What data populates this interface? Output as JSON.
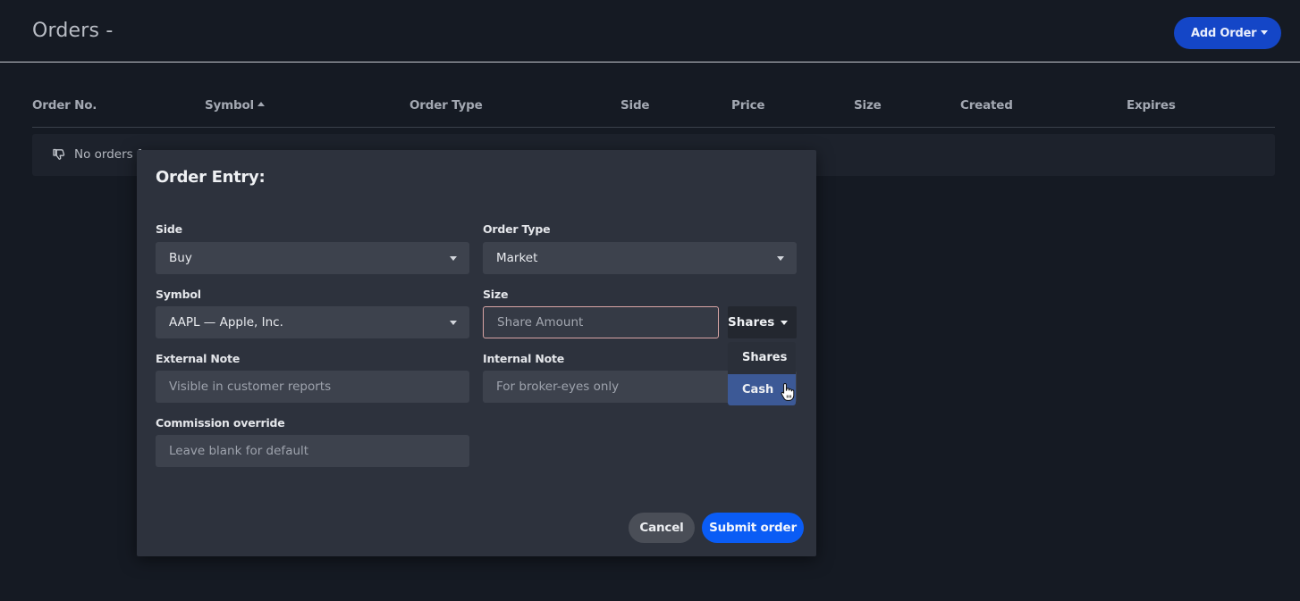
{
  "header": {
    "title": "Orders -",
    "add_order_label": "Add Order"
  },
  "table": {
    "columns": [
      "Order No.",
      "Symbol",
      "Order Type",
      "Side",
      "Price",
      "Size",
      "Created",
      "Expires"
    ],
    "sorted_column": "Symbol",
    "sort_direction": "ascending",
    "empty_message": "No orders f"
  },
  "modal": {
    "title": "Order Entry:",
    "side": {
      "label": "Side",
      "value": "Buy"
    },
    "order_type": {
      "label": "Order Type",
      "value": "Market"
    },
    "symbol": {
      "label": "Symbol",
      "value": "AAPL — Apple, Inc."
    },
    "size": {
      "label": "Size",
      "placeholder": "Share Amount",
      "unit_selected": "Shares",
      "unit_options": [
        "Shares",
        "Cash"
      ],
      "highlighted_option": "Cash"
    },
    "external_note": {
      "label": "External Note",
      "placeholder": "Visible in customer reports"
    },
    "internal_note": {
      "label": "Internal Note",
      "placeholder": "For broker-eyes only"
    },
    "commission": {
      "label": "Commission override",
      "placeholder": "Leave blank for default"
    },
    "cancel_label": "Cancel",
    "submit_label": "Submit order"
  },
  "colors": {
    "background": "#151a23",
    "modal": "#2d323d",
    "primary": "#0a5cf5",
    "add_order": "#1446c7",
    "highlight": "#3c5996"
  },
  "icons": {
    "empty_state": "thumbs-down-icon",
    "sort": "caret-up-icon",
    "dropdown": "caret-down-icon",
    "cursor": "hand-pointer-icon"
  }
}
